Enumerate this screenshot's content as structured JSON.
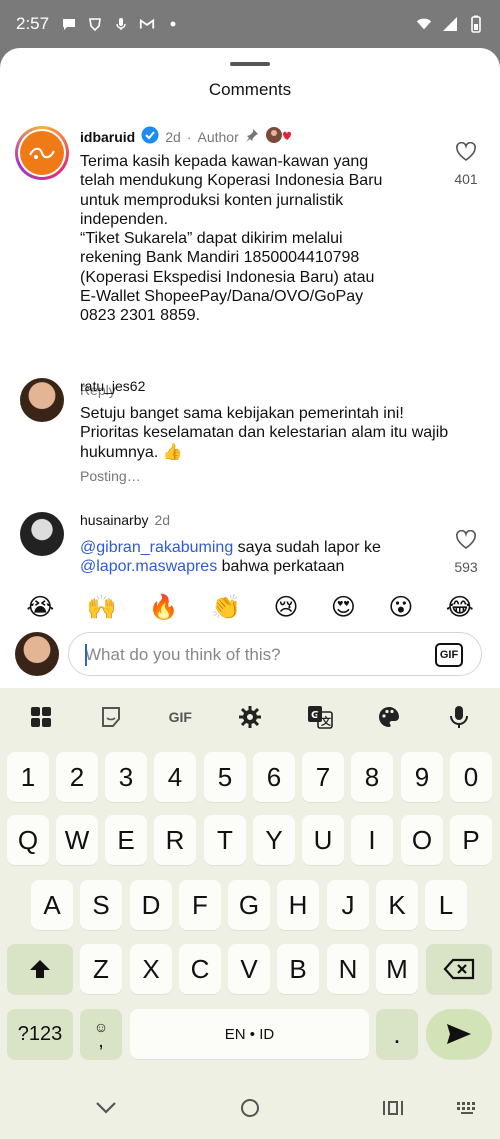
{
  "status_bar": {
    "time": "2:57"
  },
  "sheet": {
    "title": "Comments"
  },
  "comments": [
    {
      "username": "idbaruid",
      "age": "2d",
      "role_label": "Author",
      "text": "Terima kasih kepada kawan-kawan yang\ntelah mendukung Koperasi Indonesia Baru\nuntuk memproduksi konten jurnalistik\nindependen.\n“Tiket Sukarela” dapat dikirim melalui\nrekening Bank Mandiri 1850004410798\n(Koperasi Ekspedisi Indonesia Baru) atau\nE-Wallet ShopeePay/Dana/OVO/GoPay\n0823 2301 8859.",
      "action": "Reply",
      "likes": "401"
    },
    {
      "username": "ratu_jes62",
      "text": "Setuju banget sama kebijakan pemerintah ini!\nPrioritas keselamatan dan kelestarian alam itu wajib\nhukumnya. 👍",
      "action": "Posting…"
    },
    {
      "username": "husainarby",
      "age": "2d",
      "mention1": "@gibran_rakabuming",
      "text1": " saya sudah lapor ke",
      "mention2": "@lapor.maswapres",
      "text2": " bahwa perkataan",
      "likes": "593"
    }
  ],
  "emoji_bar": [
    "😭",
    "🙌",
    "🔥",
    "👏",
    "😢",
    "😍",
    "😮",
    "😂"
  ],
  "composer": {
    "placeholder": "What do you think of this?",
    "gif_label": "GIF"
  },
  "keyboard": {
    "toolbar": {
      "gif_label": "GIF"
    },
    "number_row": [
      "1",
      "2",
      "3",
      "4",
      "5",
      "6",
      "7",
      "8",
      "9",
      "0"
    ],
    "row1": [
      "Q",
      "W",
      "E",
      "R",
      "T",
      "Y",
      "U",
      "I",
      "O",
      "P"
    ],
    "row2": [
      "A",
      "S",
      "D",
      "F",
      "G",
      "H",
      "J",
      "K",
      "L"
    ],
    "row3": [
      "Z",
      "X",
      "C",
      "V",
      "B",
      "N",
      "M"
    ],
    "symbols_label": "?123",
    "comma_label": ",",
    "space_label": "EN • ID",
    "period_label": "."
  }
}
